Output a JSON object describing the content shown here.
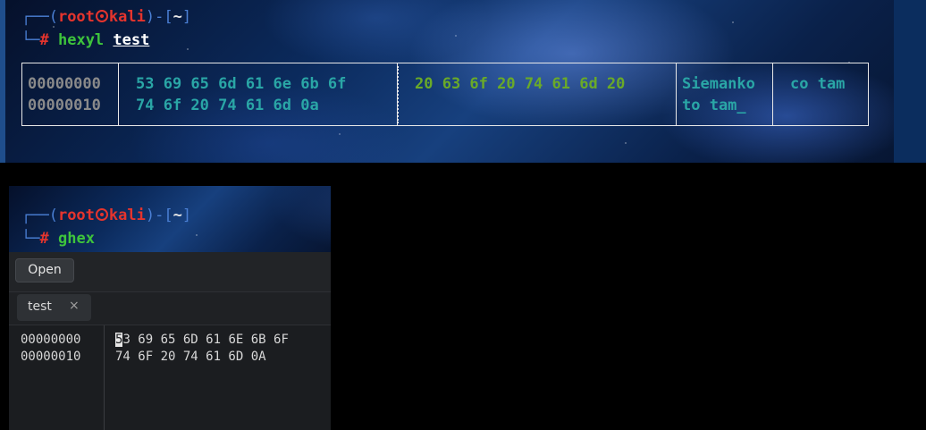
{
  "terminal1": {
    "prompt": {
      "corner": "┌──(",
      "user": "root",
      "host": "kali",
      "mid": ")-[",
      "dir": "~",
      "end": "]"
    },
    "cmd_prefix": "└─",
    "hash": "#",
    "command": "hexyl",
    "argument": "test",
    "hexyl": {
      "offsets": [
        "00000000",
        "00000010"
      ],
      "row1_hex_left": "53 69 65 6d 61 6e 6b 6f",
      "row1_hex_right": "20 63 6f 20 74 61 6d 20",
      "row2_hex_left": "74 6f 20 74 61 6d 0a",
      "row1_ascii_left": "Siemanko",
      "row1_ascii_right": "co tam",
      "row2_ascii_left": "to tam_"
    }
  },
  "terminal2": {
    "prompt": {
      "corner": "┌──(",
      "user": "root",
      "host": "kali",
      "mid": ")-[",
      "dir": "~",
      "end": "]"
    },
    "cmd_prefix": "└─",
    "hash": "#",
    "command": "ghex"
  },
  "ghex": {
    "open_label": "Open",
    "tab_label": "test",
    "tab_close": "×",
    "offsets": [
      "00000000",
      "00000010"
    ],
    "row1_cursor_char": "5",
    "row1_hex_rest": "3 69 65 6D 61 6E 6B 6F",
    "row2_hex": "74 6F 20 74 61 6D 0A"
  },
  "colors": {
    "prompt_red": "#e5342d",
    "prompt_blue": "#3f7cd6",
    "command_green": "#3ec43c",
    "hex_cyan": "#2aa6a6",
    "hex_green": "#6aaa28"
  }
}
